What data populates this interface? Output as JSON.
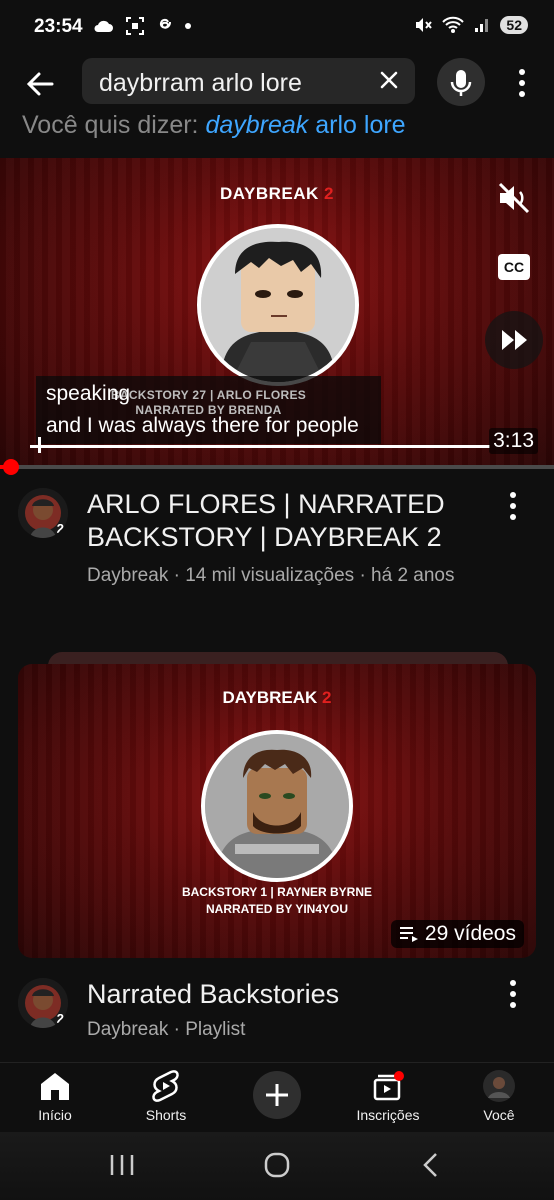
{
  "status": {
    "time": "23:54",
    "left_icons": [
      "cloud-icon",
      "screenshot-icon",
      "threads-icon",
      "dot-icon"
    ],
    "right_icons": [
      "mute-status-icon",
      "wifi-icon",
      "signal-icon"
    ],
    "battery": "52"
  },
  "search": {
    "query": "daybrram arlo lore",
    "suggest_prefix": "Você quis dizer:",
    "suggest_corrected": "daybreak",
    "suggest_rest": "arlo lore"
  },
  "video": {
    "thumb_title": "DAYBREAK",
    "thumb_num": "2",
    "backstory_line1": "BACKSTORY 27 | ARLO FLORES",
    "backstory_line2": "NARRATED BY BRENDA",
    "subtitle_1": "speaking",
    "subtitle_2": "and I was always there for people",
    "duration": "3:13",
    "cc_label": "CC",
    "progress": 0.02,
    "title": "ARLO FLORES | NARRATED BACKSTORY | DAYBREAK 2",
    "meta": "Daybreak · 14 mil visualizações · há 2 anos",
    "channel_badge": "2"
  },
  "playlist": {
    "thumb_title": "DAYBREAK",
    "thumb_num": "2",
    "caption_line1": "BACKSTORY 1 | RAYNER BYRNE",
    "caption_line2": "NARRATED BY YIN4YOU",
    "count": "29 vídeos",
    "title": "Narrated Backstories",
    "meta": "Daybreak · Playlist",
    "channel_badge": "2"
  },
  "nav": {
    "home": "Início",
    "shorts": "Shorts",
    "subscriptions": "Inscrições",
    "you": "Você"
  },
  "colors": {
    "background": "#0f0f0f",
    "accent_red": "#ff0000",
    "link_blue": "#3ea6ff"
  }
}
